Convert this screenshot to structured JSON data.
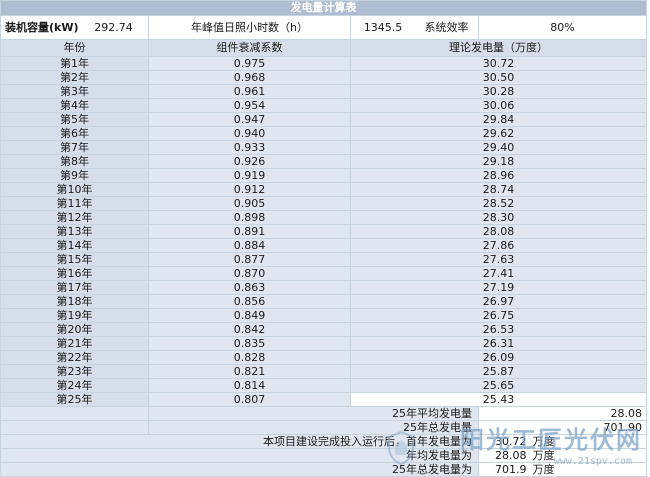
{
  "title": "发电量计算表",
  "info": {
    "capacity_label": "装机容量(kW)",
    "capacity_value": "292.74",
    "sun_hours_label": "年峰值日照小时数（h）",
    "sun_hours_value": "1345.5",
    "efficiency_label": "系统效率",
    "efficiency_value": "80%"
  },
  "columns": [
    "年份",
    "组件衰减系数",
    "理论发电量（万度）"
  ],
  "rows": [
    {
      "year": "第1年",
      "decay": "0.975",
      "power": "30.72"
    },
    {
      "year": "第2年",
      "decay": "0.968",
      "power": "30.50"
    },
    {
      "year": "第3年",
      "decay": "0.961",
      "power": "30.28"
    },
    {
      "year": "第4年",
      "decay": "0.954",
      "power": "30.06"
    },
    {
      "year": "第5年",
      "decay": "0.947",
      "power": "29.84"
    },
    {
      "year": "第6年",
      "decay": "0.940",
      "power": "29.62"
    },
    {
      "year": "第7年",
      "decay": "0.933",
      "power": "29.40"
    },
    {
      "year": "第8年",
      "decay": "0.926",
      "power": "29.18"
    },
    {
      "year": "第9年",
      "decay": "0.919",
      "power": "28.96"
    },
    {
      "year": "第10年",
      "decay": "0.912",
      "power": "28.74"
    },
    {
      "year": "第11年",
      "decay": "0.905",
      "power": "28.52"
    },
    {
      "year": "第12年",
      "decay": "0.898",
      "power": "28.30"
    },
    {
      "year": "第13年",
      "decay": "0.891",
      "power": "28.08"
    },
    {
      "year": "第14年",
      "decay": "0.884",
      "power": "27.86"
    },
    {
      "year": "第15年",
      "decay": "0.877",
      "power": "27.63"
    },
    {
      "year": "第16年",
      "decay": "0.870",
      "power": "27.41"
    },
    {
      "year": "第17年",
      "decay": "0.863",
      "power": "27.19"
    },
    {
      "year": "第18年",
      "decay": "0.856",
      "power": "26.97"
    },
    {
      "year": "第19年",
      "decay": "0.849",
      "power": "26.75"
    },
    {
      "year": "第20年",
      "decay": "0.842",
      "power": "26.53"
    },
    {
      "year": "第21年",
      "decay": "0.835",
      "power": "26.31"
    },
    {
      "year": "第22年",
      "decay": "0.828",
      "power": "26.09"
    },
    {
      "year": "第23年",
      "decay": "0.821",
      "power": "25.87"
    },
    {
      "year": "第24年",
      "decay": "0.814",
      "power": "25.65"
    },
    {
      "year": "第25年",
      "decay": "0.807",
      "power": "25.43"
    }
  ],
  "summary": {
    "avg25_label": "25年平均发电量",
    "avg25_value": "28.08",
    "total25_label": "25年总发电量",
    "total25_value": "701.90",
    "first_year_label": "本项目建设完成投入运行后，首年发电量为",
    "first_year_value": "30.72",
    "first_year_unit": "万度",
    "annual_avg_label": "年均发电量为",
    "annual_avg_value": "28.08",
    "annual_avg_unit": "万度",
    "total_label": "25年总发电量为",
    "total_value": "701.9",
    "total_unit": "万度"
  },
  "watermark": {
    "text": "阳光工匠光伏网",
    "url": "www.21spv.com",
    "color": "#7fa5c9"
  }
}
